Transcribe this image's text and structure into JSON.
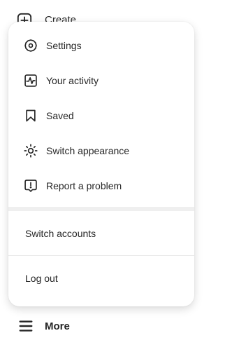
{
  "nav": {
    "create_label": "Create",
    "more_label": "More"
  },
  "menu": {
    "items": [
      {
        "label": "Settings",
        "icon": "settings-icon"
      },
      {
        "label": "Your activity",
        "icon": "activity-icon"
      },
      {
        "label": "Saved",
        "icon": "bookmark-icon"
      },
      {
        "label": "Switch appearance",
        "icon": "sun-icon"
      },
      {
        "label": "Report a problem",
        "icon": "report-icon"
      }
    ],
    "switch_accounts_label": "Switch accounts",
    "logout_label": "Log out"
  },
  "colors": {
    "text": "#262626",
    "separator": "#efefef",
    "background": "#ffffff"
  }
}
